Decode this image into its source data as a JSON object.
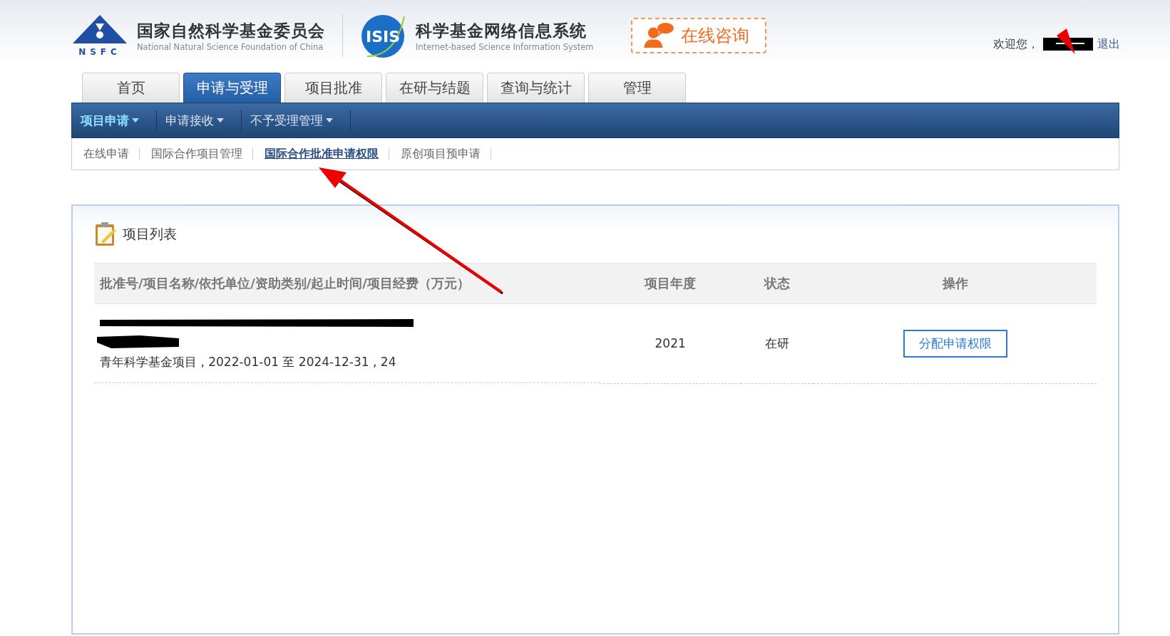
{
  "header": {
    "nsfc_logo_text": "NSFC",
    "org_name": "国家自然科学基金委员会",
    "org_name_en": "National Natural Science Foundation of China",
    "isis_logo_text": "ISIS",
    "system_name": "科学基金网络信息系统",
    "system_name_en": "Internet-based Science Information System",
    "consult_button": "在线咨询",
    "welcome": "欢迎您，",
    "logout": "退出"
  },
  "tabs": [
    {
      "label": "首页",
      "selected": false
    },
    {
      "label": "申请与受理",
      "selected": true
    },
    {
      "label": "项目批准",
      "selected": false
    },
    {
      "label": "在研与结题",
      "selected": false
    },
    {
      "label": "查询与统计",
      "selected": false
    },
    {
      "label": "管理",
      "selected": false
    }
  ],
  "menu": [
    {
      "label": "项目申请",
      "selected": true
    },
    {
      "label": "申请接收",
      "selected": false
    },
    {
      "label": "不予受理管理",
      "selected": false
    }
  ],
  "submenu": [
    {
      "label": "在线申请",
      "selected": false
    },
    {
      "label": "国际合作项目管理",
      "selected": false
    },
    {
      "label": "国际合作批准申请权限",
      "selected": true
    },
    {
      "label": "原创项目预申请",
      "selected": false
    }
  ],
  "panel": {
    "title": "项目列表",
    "table": {
      "columns": [
        "批准号/项目名称/依托单位/资助类别/起止时间/项目经费（万元）",
        "项目年度",
        "状态",
        "操作"
      ],
      "rows": [
        {
          "details": "青年科学基金项目 , 2022-01-01 至 2024-12-31 , 24",
          "year": "2021",
          "status": "在研",
          "action": "分配申请权限"
        }
      ]
    }
  }
}
